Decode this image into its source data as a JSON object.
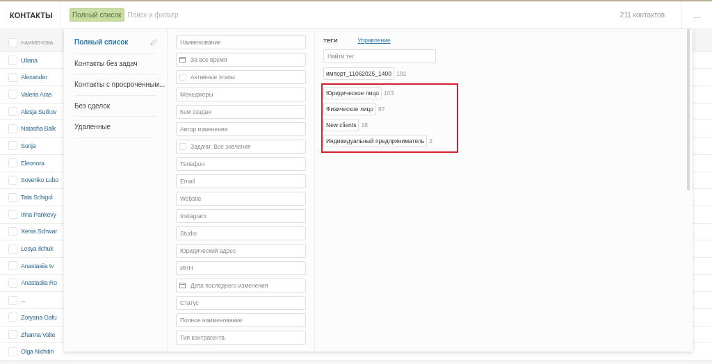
{
  "header": {
    "title": "КОНТАКТЫ",
    "active_filter": "Полный список",
    "search": {
      "placeholder": "Поиск и фильтр"
    },
    "count": "211 контактов",
    "more": "..."
  },
  "table": {
    "select_all": {
      "checked": false
    },
    "columns": [
      "НАИМЕНОВА"
    ],
    "rows": [
      {
        "name": "Uliana",
        "checked": false
      },
      {
        "name": "Alexander",
        "checked": false
      },
      {
        "name": "Valeria Aras",
        "checked": false
      },
      {
        "name": "Alesja Surkov",
        "checked": false
      },
      {
        "name": "Natasha Balk",
        "checked": false
      },
      {
        "name": "Sonja",
        "checked": false
      },
      {
        "name": "Eleonora",
        "checked": false
      },
      {
        "name": "Sovenko Lubo",
        "checked": false
      },
      {
        "name": "Tata Schigol",
        "checked": false
      },
      {
        "name": "Irina Pankevy",
        "checked": false
      },
      {
        "name": "Xenia Schwar",
        "checked": false
      },
      {
        "name": "Lesya Ilchuk",
        "checked": false
      },
      {
        "name": "Anastasiia Iv",
        "checked": false
      },
      {
        "name": "Anastasiia Ro",
        "checked": false
      },
      {
        "name": "...",
        "checked": false
      },
      {
        "name": "Zoryana Gafu",
        "checked": false
      },
      {
        "name": "Zhanna Valte",
        "checked": false
      },
      {
        "name": "Olga Nichitin",
        "checked": false
      }
    ]
  },
  "filter_panel": {
    "presets": [
      {
        "label": "Полный список",
        "selected": true
      },
      {
        "label": "Контакты без задач",
        "selected": false
      },
      {
        "label": "Контакты с просроченным...",
        "selected": false
      },
      {
        "label": "Без сделок",
        "selected": false
      },
      {
        "label": "Удаленные",
        "selected": false
      }
    ],
    "fields": [
      {
        "kind": "text",
        "placeholder": "Наименование"
      },
      {
        "kind": "date",
        "placeholder": "За все время"
      },
      {
        "kind": "checkbox",
        "placeholder": "Активные этапы",
        "checked": false
      },
      {
        "kind": "text",
        "placeholder": "Менеджеры"
      },
      {
        "kind": "text",
        "placeholder": "Кем создан"
      },
      {
        "kind": "text",
        "placeholder": "Автор изменения"
      },
      {
        "kind": "checkbox",
        "placeholder": "Задачи: Все значения",
        "checked": false
      },
      {
        "kind": "text",
        "placeholder": "Телефон"
      },
      {
        "kind": "text",
        "placeholder": "Email"
      },
      {
        "kind": "text",
        "placeholder": "Website"
      },
      {
        "kind": "text",
        "placeholder": "Instagram"
      },
      {
        "kind": "text",
        "placeholder": "Studio"
      },
      {
        "kind": "text",
        "placeholder": "Юридический адрес"
      },
      {
        "kind": "text",
        "placeholder": "ИНН"
      },
      {
        "kind": "date",
        "placeholder": "Дата последнего изменения"
      },
      {
        "kind": "text",
        "placeholder": "Статус"
      },
      {
        "kind": "text",
        "placeholder": "Полное наименование"
      },
      {
        "kind": "text",
        "placeholder": "Тип контрагента"
      }
    ],
    "tags": {
      "title": "ТЕГИ",
      "manage_link": "Управление",
      "search": {
        "placeholder": "Найти тег"
      },
      "items": [
        {
          "label": "импорт_11062025_1400",
          "count": "192",
          "highlighted": false
        },
        {
          "label": "Юридическое лицо",
          "count": "103",
          "highlighted": true
        },
        {
          "label": "Физическое лицо",
          "count": "87",
          "highlighted": true
        },
        {
          "label": "New clients",
          "count": "18",
          "highlighted": true
        },
        {
          "label": "Индивидуальный предприниматель",
          "count": "2",
          "highlighted": true
        }
      ]
    }
  }
}
